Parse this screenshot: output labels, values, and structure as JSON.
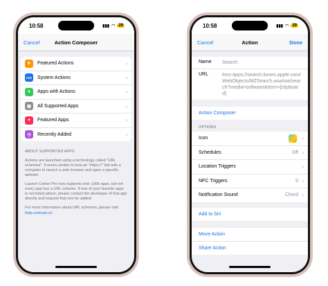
{
  "status": {
    "time": "10:58",
    "battery": "29"
  },
  "left": {
    "nav": {
      "cancel": "Cancel",
      "title": "Action Composer"
    },
    "items": [
      {
        "label": "Featured Actions",
        "icon": "star-icon",
        "color": "#ff9500"
      },
      {
        "label": "System Actions",
        "icon": "ios-icon",
        "color": "#1a73e8",
        "glyph": "iOS"
      },
      {
        "label": "Apps with Actions",
        "icon": "apps-icon",
        "color": "#34c759"
      },
      {
        "label": "All Supported Apps",
        "icon": "grid-icon",
        "color": "#8e8e93"
      },
      {
        "label": "Featured Apps",
        "icon": "heart-icon",
        "color": "#ff2d55"
      },
      {
        "label": "Recently Added",
        "icon": "clock-icon",
        "color": "#af52de"
      }
    ],
    "about_header": "ABOUT SUPPORTED APPS",
    "about_p1": "Actions are launched using a technology called \"URL schemes\". It works similar to how an \"https://\" link tells a computer to launch a web browser and open a specific website.",
    "about_p2": "Launch Center Pro now supports over 100k apps, but not every app has a URL scheme. If one of your favorite apps is not listed above, please contact the developer of that app directly and request that one be added.",
    "about_p3": "For more information about URL schemes, please visit:",
    "about_link": "help.contrast.co"
  },
  "right": {
    "nav": {
      "cancel": "Cancel",
      "title": "Action",
      "done": "Done"
    },
    "name_label": "Name",
    "name_placeholder": "Search",
    "url_label": "URL",
    "url_value": "itms-apps://search.itunes.apple.com/WebObjects/MZSearch.woa/wa/search?media=software&term=[clipboard]",
    "action_composer": "Action Composer",
    "options_header": "OPTIONS",
    "options": [
      {
        "label": "Icon",
        "value": ""
      },
      {
        "label": "Schedules",
        "value": "Off"
      },
      {
        "label": "Location Triggers",
        "value": ""
      },
      {
        "label": "NFC Triggers",
        "value": "0"
      },
      {
        "label": "Notification Sound",
        "value": "Chord"
      }
    ],
    "add_to_siri": "Add to Siri",
    "move_action": "Move Action",
    "share_action": "Share Action"
  }
}
